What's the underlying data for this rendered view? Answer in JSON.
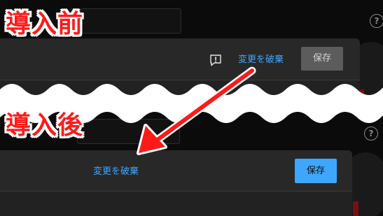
{
  "labels": {
    "before": "導入前",
    "after": "導入後"
  },
  "before": {
    "discard_label": "変更を破棄",
    "save_label": "保存",
    "help_glyph": "?",
    "feedback_icon": "report-feedback-icon"
  },
  "after": {
    "discard_label": "変更を破棄",
    "save_label": "保存",
    "help_glyph": "?"
  },
  "colors": {
    "link_blue": "#3ea6ff",
    "caption_red": "#ff1a1a",
    "save_disabled": "#5c5c5c",
    "save_enabled": "#3ea6ff"
  }
}
